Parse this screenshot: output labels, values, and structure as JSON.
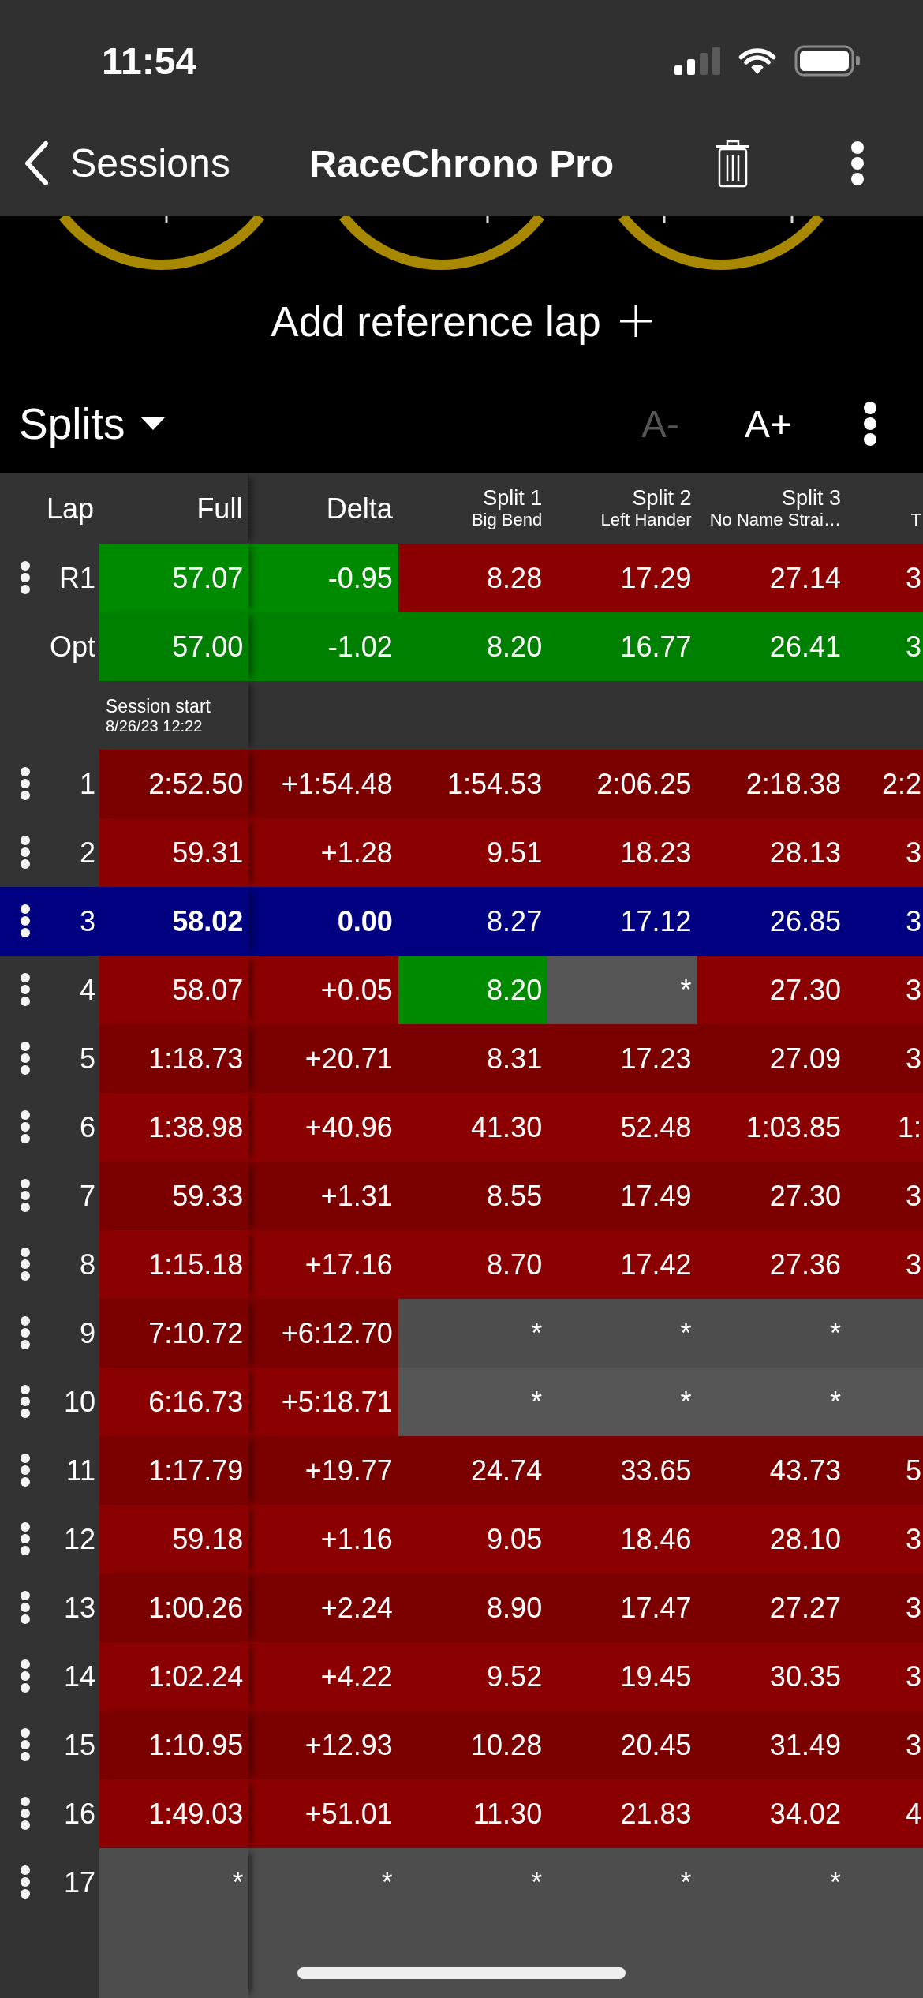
{
  "status_bar": {
    "time": "11:54"
  },
  "nav_bar": {
    "back_label": "Sessions",
    "title": "RaceChrono Pro"
  },
  "reference": {
    "add_label": "Add reference lap"
  },
  "toolbar": {
    "view": "Splits",
    "font_buttons": [
      {
        "label": "A-",
        "disabled": true
      },
      {
        "label": "A+",
        "disabled": false
      }
    ]
  },
  "table": {
    "columns": [
      {
        "label": "Lap"
      },
      {
        "label": "Full"
      },
      {
        "label": "Delta"
      },
      {
        "label": "Split 1",
        "sublabel": "Big Bend"
      },
      {
        "label": "Split 2",
        "sublabel": "Left Hander"
      },
      {
        "label": "Split 3",
        "sublabel": "No Name Strai…"
      },
      {
        "sublabel": "T"
      }
    ],
    "rows": [
      {
        "kind": "lap",
        "lap": "R1",
        "menu": true,
        "selected": false,
        "cells": [
          {
            "text": "57.07",
            "color": "#008a00"
          },
          {
            "text": "-0.95",
            "color": "#008a00"
          },
          {
            "text": "8.28",
            "color": "#8b0000"
          },
          {
            "text": "17.29",
            "color": "#8b0000"
          },
          {
            "text": "27.14",
            "color": "#8b0000"
          },
          {
            "text": "3",
            "color": "#8b0000"
          }
        ]
      },
      {
        "kind": "lap",
        "lap": "Opt",
        "menu": false,
        "selected": false,
        "cells": [
          {
            "text": "57.00",
            "color": "#008000"
          },
          {
            "text": "-1.02",
            "color": "#008000"
          },
          {
            "text": "8.20",
            "color": "#008000"
          },
          {
            "text": "16.77",
            "color": "#008000"
          },
          {
            "text": "26.41",
            "color": "#008000"
          },
          {
            "text": "3",
            "color": "#008000"
          }
        ]
      },
      {
        "kind": "session_start",
        "label": "Session start",
        "date": "8/26/23 12:22"
      },
      {
        "kind": "lap",
        "lap": "1",
        "menu": true,
        "selected": false,
        "cells": [
          {
            "text": "2:52.50",
            "color": "#7b0000"
          },
          {
            "text": "+1:54.48",
            "color": "#7b0000"
          },
          {
            "text": "1:54.53",
            "color": "#7b0000"
          },
          {
            "text": "2:06.25",
            "color": "#7b0000"
          },
          {
            "text": "2:18.38",
            "color": "#7b0000"
          },
          {
            "text": "2:2",
            "color": "#7b0000"
          }
        ]
      },
      {
        "kind": "lap",
        "lap": "2",
        "menu": true,
        "selected": false,
        "cells": [
          {
            "text": "59.31",
            "color": "#8b0000"
          },
          {
            "text": "+1.28",
            "color": "#8b0000"
          },
          {
            "text": "9.51",
            "color": "#8b0000"
          },
          {
            "text": "18.23",
            "color": "#8b0000"
          },
          {
            "text": "28.13",
            "color": "#8b0000"
          },
          {
            "text": "3",
            "color": "#8b0000"
          }
        ]
      },
      {
        "kind": "lap",
        "lap": "3",
        "menu": true,
        "selected": true,
        "cells": [
          {
            "text": "58.02",
            "color": "#000080"
          },
          {
            "text": "0.00",
            "color": "#000080"
          },
          {
            "text": "8.27",
            "color": "#000080"
          },
          {
            "text": "17.12",
            "color": "#000080"
          },
          {
            "text": "26.85",
            "color": "#000080"
          },
          {
            "text": "3",
            "color": "#000080"
          }
        ]
      },
      {
        "kind": "lap",
        "lap": "4",
        "menu": true,
        "selected": false,
        "cells": [
          {
            "text": "58.07",
            "color": "#8b0000"
          },
          {
            "text": "+0.05",
            "color": "#8b0000"
          },
          {
            "text": "8.20",
            "color": "#008a00"
          },
          {
            "text": "*",
            "color": "#555555"
          },
          {
            "text": "27.30",
            "color": "#8b0000"
          },
          {
            "text": "3",
            "color": "#8b0000"
          }
        ]
      },
      {
        "kind": "lap",
        "lap": "5",
        "menu": true,
        "selected": false,
        "cells": [
          {
            "text": "1:18.73",
            "color": "#7b0000"
          },
          {
            "text": "+20.71",
            "color": "#7b0000"
          },
          {
            "text": "8.31",
            "color": "#7b0000"
          },
          {
            "text": "17.23",
            "color": "#7b0000"
          },
          {
            "text": "27.09",
            "color": "#7b0000"
          },
          {
            "text": "3",
            "color": "#7b0000"
          }
        ]
      },
      {
        "kind": "lap",
        "lap": "6",
        "menu": true,
        "selected": false,
        "cells": [
          {
            "text": "1:38.98",
            "color": "#8b0000"
          },
          {
            "text": "+40.96",
            "color": "#8b0000"
          },
          {
            "text": "41.30",
            "color": "#8b0000"
          },
          {
            "text": "52.48",
            "color": "#8b0000"
          },
          {
            "text": "1:03.85",
            "color": "#8b0000"
          },
          {
            "text": "1:",
            "color": "#8b0000"
          }
        ]
      },
      {
        "kind": "lap",
        "lap": "7",
        "menu": true,
        "selected": false,
        "cells": [
          {
            "text": "59.33",
            "color": "#7b0000"
          },
          {
            "text": "+1.31",
            "color": "#7b0000"
          },
          {
            "text": "8.55",
            "color": "#7b0000"
          },
          {
            "text": "17.49",
            "color": "#7b0000"
          },
          {
            "text": "27.30",
            "color": "#7b0000"
          },
          {
            "text": "3",
            "color": "#7b0000"
          }
        ]
      },
      {
        "kind": "lap",
        "lap": "8",
        "menu": true,
        "selected": false,
        "cells": [
          {
            "text": "1:15.18",
            "color": "#8b0000"
          },
          {
            "text": "+17.16",
            "color": "#8b0000"
          },
          {
            "text": "8.70",
            "color": "#8b0000"
          },
          {
            "text": "17.42",
            "color": "#8b0000"
          },
          {
            "text": "27.36",
            "color": "#8b0000"
          },
          {
            "text": "3",
            "color": "#8b0000"
          }
        ]
      },
      {
        "kind": "lap",
        "lap": "9",
        "menu": true,
        "selected": false,
        "cells": [
          {
            "text": "7:10.72",
            "color": "#7b0000"
          },
          {
            "text": "+6:12.70",
            "color": "#7b0000"
          },
          {
            "text": "*",
            "color": "#4d4d4d"
          },
          {
            "text": "*",
            "color": "#4d4d4d"
          },
          {
            "text": "*",
            "color": "#4d4d4d"
          },
          {
            "color": "#4d4d4d"
          }
        ]
      },
      {
        "kind": "lap",
        "lap": "10",
        "menu": true,
        "selected": false,
        "cells": [
          {
            "text": "6:16.73",
            "color": "#8b0000"
          },
          {
            "text": "+5:18.71",
            "color": "#8b0000"
          },
          {
            "text": "*",
            "color": "#555555"
          },
          {
            "text": "*",
            "color": "#555555"
          },
          {
            "text": "*",
            "color": "#555555"
          },
          {
            "color": "#555555"
          }
        ]
      },
      {
        "kind": "lap",
        "lap": "11",
        "menu": true,
        "selected": false,
        "cells": [
          {
            "text": "1:17.79",
            "color": "#7b0000"
          },
          {
            "text": "+19.77",
            "color": "#7b0000"
          },
          {
            "text": "24.74",
            "color": "#7b0000"
          },
          {
            "text": "33.65",
            "color": "#7b0000"
          },
          {
            "text": "43.73",
            "color": "#7b0000"
          },
          {
            "text": "5",
            "color": "#7b0000"
          }
        ]
      },
      {
        "kind": "lap",
        "lap": "12",
        "menu": true,
        "selected": false,
        "cells": [
          {
            "text": "59.18",
            "color": "#8b0000"
          },
          {
            "text": "+1.16",
            "color": "#8b0000"
          },
          {
            "text": "9.05",
            "color": "#8b0000"
          },
          {
            "text": "18.46",
            "color": "#8b0000"
          },
          {
            "text": "28.10",
            "color": "#8b0000"
          },
          {
            "text": "3",
            "color": "#8b0000"
          }
        ]
      },
      {
        "kind": "lap",
        "lap": "13",
        "menu": true,
        "selected": false,
        "cells": [
          {
            "text": "1:00.26",
            "color": "#7b0000"
          },
          {
            "text": "+2.24",
            "color": "#7b0000"
          },
          {
            "text": "8.90",
            "color": "#7b0000"
          },
          {
            "text": "17.47",
            "color": "#7b0000"
          },
          {
            "text": "27.27",
            "color": "#7b0000"
          },
          {
            "text": "3",
            "color": "#7b0000"
          }
        ]
      },
      {
        "kind": "lap",
        "lap": "14",
        "menu": true,
        "selected": false,
        "cells": [
          {
            "text": "1:02.24",
            "color": "#8b0000"
          },
          {
            "text": "+4.22",
            "color": "#8b0000"
          },
          {
            "text": "9.52",
            "color": "#8b0000"
          },
          {
            "text": "19.45",
            "color": "#8b0000"
          },
          {
            "text": "30.35",
            "color": "#8b0000"
          },
          {
            "text": "3",
            "color": "#8b0000"
          }
        ]
      },
      {
        "kind": "lap",
        "lap": "15",
        "menu": true,
        "selected": false,
        "cells": [
          {
            "text": "1:10.95",
            "color": "#7b0000"
          },
          {
            "text": "+12.93",
            "color": "#7b0000"
          },
          {
            "text": "10.28",
            "color": "#7b0000"
          },
          {
            "text": "20.45",
            "color": "#7b0000"
          },
          {
            "text": "31.49",
            "color": "#7b0000"
          },
          {
            "text": "3",
            "color": "#7b0000"
          }
        ]
      },
      {
        "kind": "lap",
        "lap": "16",
        "menu": true,
        "selected": false,
        "cells": [
          {
            "text": "1:49.03",
            "color": "#8b0000"
          },
          {
            "text": "+51.01",
            "color": "#8b0000"
          },
          {
            "text": "11.30",
            "color": "#8b0000"
          },
          {
            "text": "21.83",
            "color": "#8b0000"
          },
          {
            "text": "34.02",
            "color": "#8b0000"
          },
          {
            "text": "4",
            "color": "#8b0000"
          }
        ]
      },
      {
        "kind": "lap",
        "lap": "17",
        "menu": true,
        "selected": false,
        "cells": [
          {
            "text": "*",
            "color": "#4d4d4d"
          },
          {
            "text": "*",
            "color": "#4d4d4d"
          },
          {
            "text": "*",
            "color": "#4d4d4d"
          },
          {
            "text": "*",
            "color": "#4d4d4d"
          },
          {
            "text": "*",
            "color": "#4d4d4d"
          },
          {
            "color": "#4d4d4d"
          }
        ]
      }
    ]
  }
}
